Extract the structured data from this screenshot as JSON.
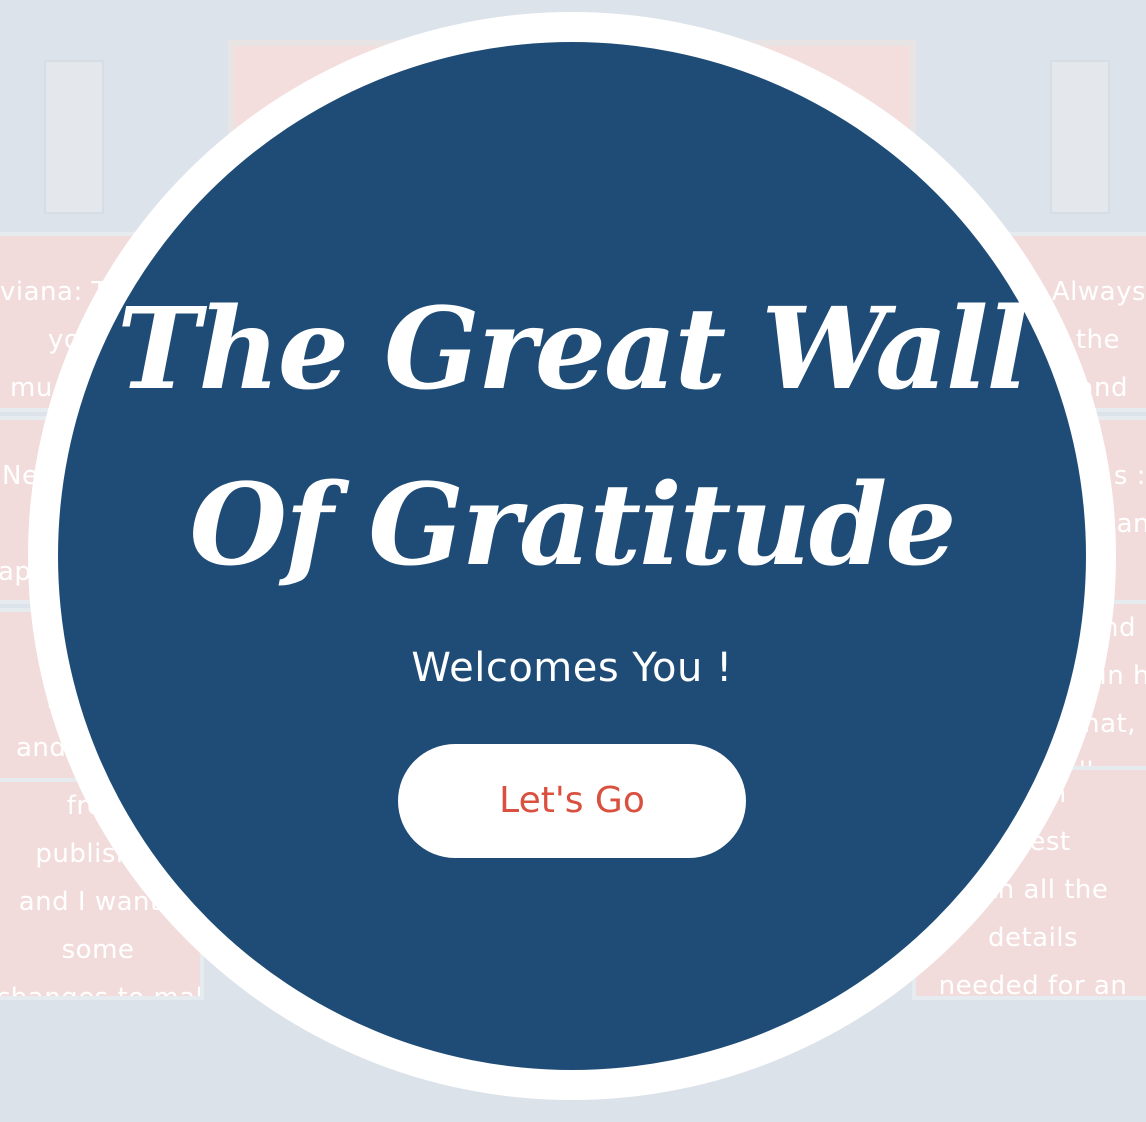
{
  "modal": {
    "title_line1": "The Great Wall",
    "title_line2": "Of Gratitude",
    "subtitle": "Welcomes You !",
    "cta_label": "Let's Go"
  },
  "background_cards": {
    "left_top": [
      "viana: T",
      "yo",
      "mu"
    ],
    "left_mid": [
      "Ne",
      "",
      "app"
    ],
    "left_lower": [
      "f",
      "and"
    ],
    "left_bottom": [
      "from",
      "publisher",
      "and I wante",
      "some",
      "changes to make"
    ],
    "right_top": [
      "Always",
      "the",
      "and"
    ],
    "right_mid": [
      "s :",
      "han"
    ],
    "right_lower": [
      "nd",
      "in h",
      "that,",
      "dly"
    ],
    "right_bottom": [
      "ough",
      "quest",
      "with all the",
      "details",
      "needed for an"
    ]
  },
  "colors": {
    "modal_bg": "#1f4c76",
    "ring": "#ffffff",
    "cta_text": "#d9503f",
    "card_bg": "#f2dcdb",
    "page_bg": "#dde3ea"
  }
}
